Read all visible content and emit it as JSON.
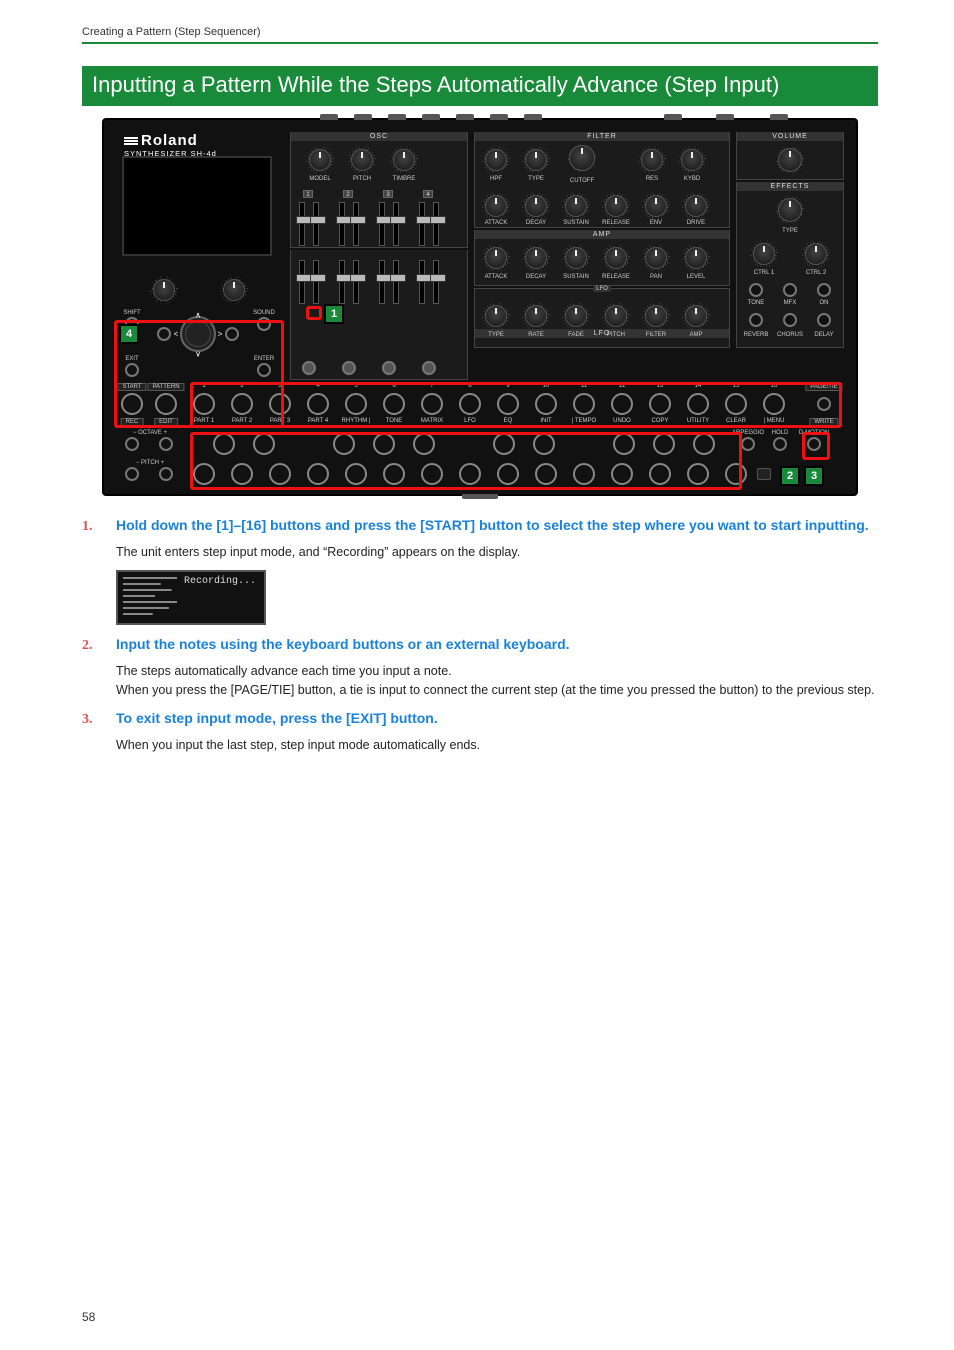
{
  "crumb": "Creating a Pattern (Step Sequencer)",
  "heading": "Inputting a Pattern While the Steps Automatically Advance (Step Input)",
  "page_number": "58",
  "panel": {
    "brand": "Roland",
    "model": "SYNTHESIZER SH-4d",
    "left": {
      "shift": "SHIFT",
      "sound": "SOUND",
      "exit": "EXIT",
      "enter": "ENTER",
      "start": "START",
      "pattern": "PATTERN",
      "rec": "REC",
      "edit": "EDIT",
      "oct_minus": "−  OCTAVE  +",
      "pitch": "−  PITCH  +",
      "up": "∧",
      "down": "∨",
      "left": "<",
      "right": ">"
    },
    "osc": {
      "title": "OSC",
      "labels": [
        "MODEL",
        "PITCH",
        "TIMBRE"
      ],
      "nums": [
        "1",
        "2",
        "3",
        "4"
      ]
    },
    "filter": {
      "title": "FILTER",
      "row1": [
        "HPF",
        "TYPE",
        "",
        "RES",
        "KYBD"
      ],
      "cutoff": "CUTOFF",
      "row2": [
        "ATTACK",
        "DECAY",
        "SUSTAIN",
        "RELEASE",
        "ENV",
        "DRIVE"
      ]
    },
    "amp": {
      "title": "AMP",
      "labels": [
        "ATTACK",
        "DECAY",
        "SUSTAIN",
        "RELEASE",
        "PAN",
        "LEVEL"
      ]
    },
    "lfo": {
      "title": "LFO",
      "labels": [
        "TYPE",
        "RATE",
        "FADE",
        "PITCH",
        "FILTER",
        "AMP"
      ]
    },
    "volume": {
      "title": "VOLUME"
    },
    "effects": {
      "title": "EFFECTS",
      "type": "TYPE",
      "ctrl": [
        "CTRL 1",
        "CTRL 2"
      ],
      "tone": "TONE",
      "mfx": "MFX",
      "on": "ON",
      "row2": [
        "REVERB",
        "CHORUS",
        "DELAY"
      ]
    },
    "step_nums": [
      "1",
      "2",
      "3",
      "4",
      "5",
      "6",
      "7",
      "8",
      "9",
      "10",
      "11",
      "12",
      "13",
      "14",
      "15",
      "16"
    ],
    "step_lbls": [
      "PART 1",
      "PART 2",
      "PART 3",
      "PART 4",
      "RHYTHM  |",
      "TONE",
      "MATRIX",
      "LFO",
      "EQ",
      "INIT",
      "|  TEMPO",
      "UNDO",
      "COPY",
      "UTILITY",
      "CLEAR",
      "|  MENU"
    ],
    "page_tie": "PAGE/TIE",
    "write": "WRITE",
    "arp": "ARPEGGIO",
    "hold": "HOLD",
    "dmotion": "D-MOTION"
  },
  "badges": {
    "b1": "1",
    "b2": "2",
    "b3": "3",
    "b4": "4"
  },
  "steps": [
    {
      "n": "1.",
      "title": "Hold down the [1]–[16] buttons and press the [START] button to select the step where you want to start inputting.",
      "body": "The unit enters step input mode, and “Recording” appears on the display."
    },
    {
      "n": "2.",
      "title": "Input the notes using the keyboard buttons or an external keyboard.",
      "body": "The steps automatically advance each time you input a note.\nWhen you press the [PAGE/TIE] button, a tie is input to connect the current step (at the time you pressed the button) to the previous step."
    },
    {
      "n": "3.",
      "title": "To exit step input mode, press the [EXIT] button.",
      "body": "When you input the last step, step input mode automatically ends."
    }
  ],
  "recording_text": "Recording..."
}
